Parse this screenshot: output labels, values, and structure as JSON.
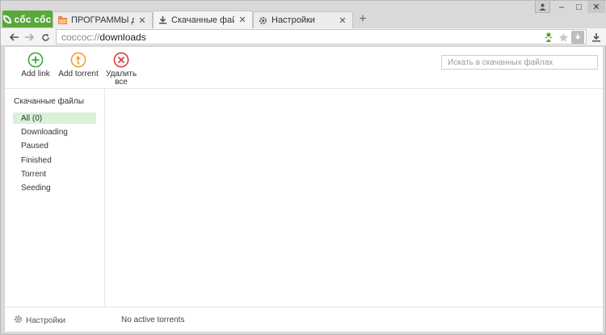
{
  "browser": {
    "logo": "cốc cốc",
    "tabs": [
      {
        "title": "ПРОГРАММЫ для Windo",
        "close": "✕",
        "icon": "folder-icon"
      },
      {
        "title": "Скачанные файлы",
        "close": "✕",
        "icon": "download-icon"
      },
      {
        "title": "Настройки",
        "close": "✕",
        "icon": "gear-icon"
      }
    ],
    "new_tab": "+",
    "window_controls": {
      "minimize": "–",
      "maximize": "□",
      "close": "✕"
    },
    "address": {
      "scheme": "coccoc://",
      "path": "downloads"
    }
  },
  "toolbar_actions": [
    {
      "label": "Add link",
      "icon": "plus-circle-icon",
      "color": "#3aaa35"
    },
    {
      "label": "Add torrent",
      "icon": "torrent-circle-icon",
      "color": "#f0a030"
    },
    {
      "label": "Удалить все",
      "icon": "x-circle-icon",
      "color": "#e03a3a"
    }
  ],
  "search": {
    "placeholder": "Искать в скачанных файлах"
  },
  "sidebar": {
    "title": "Скачанные файлы",
    "items": [
      {
        "label": "All (0)",
        "selected": true
      },
      {
        "label": "Downloading"
      },
      {
        "label": "Paused"
      },
      {
        "label": "Finished"
      },
      {
        "label": "Torrent"
      },
      {
        "label": "Seeding"
      }
    ]
  },
  "footer": {
    "settings_label": "Настройки",
    "status": "No active torrents"
  },
  "colors": {
    "accent_green": "#5aa83b",
    "selected_bg": "#d9f1d9"
  }
}
